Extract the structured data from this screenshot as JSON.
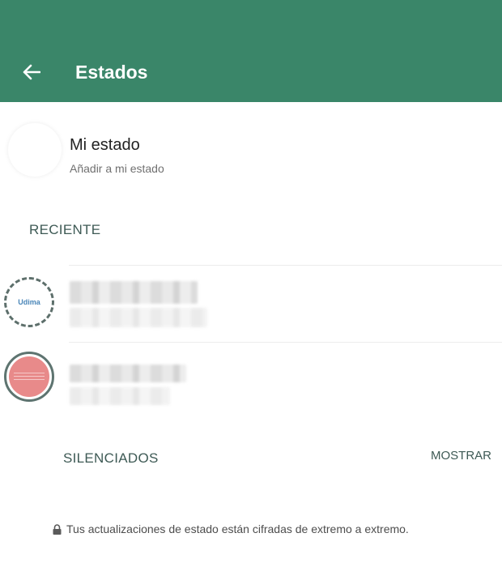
{
  "header": {
    "title": "Estados",
    "background": "#3a8669",
    "back_icon": "arrow-left-icon"
  },
  "my_status": {
    "name": "Mi estado",
    "subtitle": "Añadir a mi estado"
  },
  "recent": {
    "label": "RECIENTE",
    "contacts": [
      {
        "avatar_text": "Udima",
        "ring": "dashed"
      },
      {
        "avatar_color": "#e88a8a",
        "ring": "solid"
      }
    ]
  },
  "muted": {
    "label": "SILENCIADOS",
    "action": "MOSTRAR"
  },
  "footer": {
    "lock_icon": "lock-icon",
    "text": "Tus actualizaciones de estado están cifradas de extremo a extremo."
  }
}
